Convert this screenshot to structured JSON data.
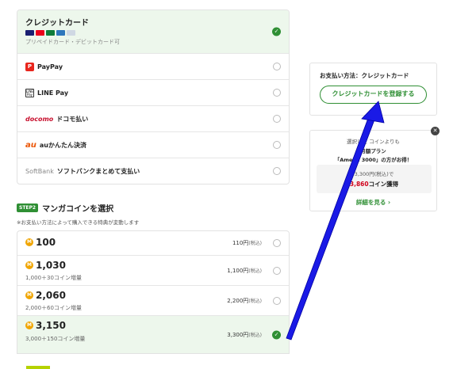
{
  "payment_methods": [
    {
      "name": "クレジットカード",
      "sub": "プリペイドカード・デビットカード可",
      "selected": true
    },
    {
      "name": "PayPay",
      "logo": "P"
    },
    {
      "name": "LINE Pay",
      "logo": "LINE Pay"
    },
    {
      "name": "ドコモ払い",
      "logo": "docomo"
    },
    {
      "name": "auかんたん決済",
      "logo": "au"
    },
    {
      "name": "ソフトバンクまとめて支払い",
      "logo": "SoftBank"
    }
  ],
  "step2": {
    "badge": "STEP2",
    "title": "マンガコインを選択",
    "note": "※お支払い方法によって購入できる特典が変動します"
  },
  "coins": [
    {
      "amount": "100",
      "bonus": "",
      "price": "110円",
      "tax": "(税込)"
    },
    {
      "amount": "1,030",
      "bonus": "1,000＋30コイン増量",
      "price": "1,100円",
      "tax": "(税込)"
    },
    {
      "amount": "2,060",
      "bonus": "2,000＋60コイン増量",
      "price": "2,200円",
      "tax": "(税込)"
    },
    {
      "amount": "3,150",
      "bonus": "3,000＋150コイン増量",
      "price": "3,300円",
      "tax": "(税込)",
      "selected": true
    }
  ],
  "coin_icon_letter": "M",
  "summary": {
    "title": "お支払い方法：クレジットカード",
    "button": "クレジットカードを登録する"
  },
  "promo": {
    "line1": "選択した  コインよりも",
    "line2": "月額プラン",
    "line3": "「Ameba  3000」の方がお得！",
    "price": "3,300円(税込)で",
    "coins_prefix": "",
    "coins_value": "3,860",
    "coins_suffix": "コイン獲得",
    "link": "詳細を見る ›"
  },
  "colors": {
    "accent_green": "#2f8f34",
    "selected_bg": "#edf7ec",
    "arrow_blue": "#1a1ae6",
    "promo_red": "#d0021b"
  }
}
